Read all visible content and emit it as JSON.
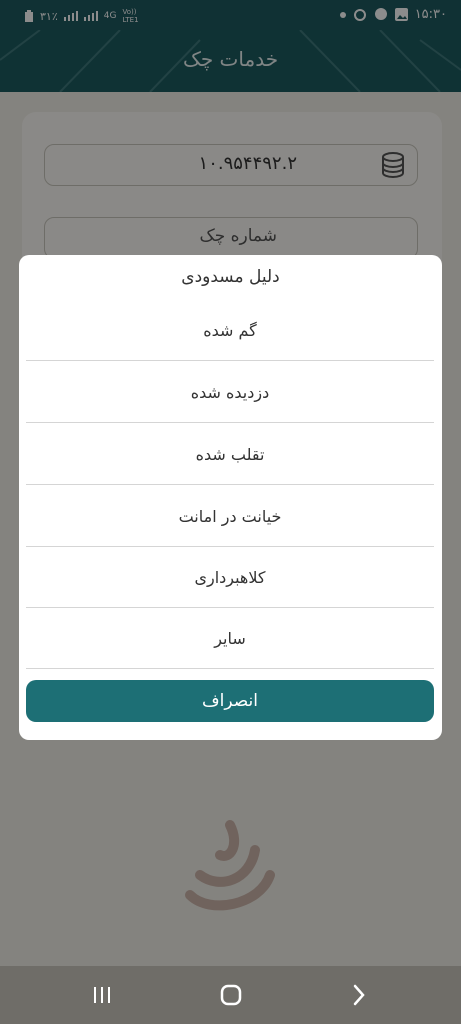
{
  "status_bar": {
    "left_text": "٣١٪",
    "network": "4G",
    "volte": "Vo)) LTE1",
    "time": "۱۵:۳۰"
  },
  "app_bar": {
    "title": "خدمات چک"
  },
  "form": {
    "amount_value": "۱۰.۹۵۴۴۹۲.۲",
    "cheque_number_label": "شماره چک"
  },
  "dialog": {
    "title": "دلیل مسدودی",
    "options": [
      {
        "label": "گم شده"
      },
      {
        "label": "دزدیده شده"
      },
      {
        "label": "تقلب شده"
      },
      {
        "label": "خیانت در امانت"
      },
      {
        "label": "کلاهبرداری"
      },
      {
        "label": "سایر"
      }
    ],
    "cancel_label": "انصراف"
  },
  "colors": {
    "primary": "#1d6f75",
    "app_bar": "#1d5b60",
    "nav_bar": "#6f6d68"
  },
  "icons": [
    "battery-icon",
    "signal-icon",
    "coins-icon",
    "nav-recent-icon",
    "nav-home-icon",
    "nav-back-icon"
  ]
}
